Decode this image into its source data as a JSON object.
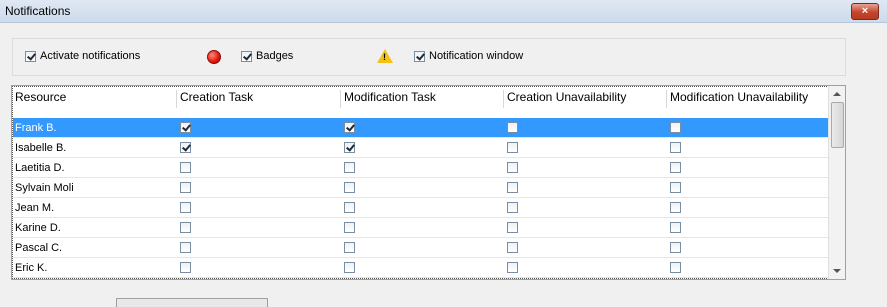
{
  "window": {
    "title": "Notifications",
    "close_label": "×"
  },
  "options": {
    "activate": {
      "label": "Activate notifications",
      "checked": true
    },
    "badges": {
      "label": "Badges",
      "checked": true
    },
    "window": {
      "label": "Notification window",
      "checked": true
    }
  },
  "icons": {
    "status_dot": "red-circle-icon",
    "warning": "warning-triangle-icon"
  },
  "columns": [
    "Resource",
    "Creation Task",
    "Modification Task",
    "Creation Unavailability",
    "Modification Unavailability"
  ],
  "rows": [
    {
      "name": "Frank B.",
      "checks": [
        true,
        true,
        false,
        false
      ],
      "selected": true
    },
    {
      "name": "Isabelle B.",
      "checks": [
        true,
        true,
        false,
        false
      ],
      "selected": false
    },
    {
      "name": "Laetitia D.",
      "checks": [
        false,
        false,
        false,
        false
      ],
      "selected": false
    },
    {
      "name": "Sylvain Moli",
      "checks": [
        false,
        false,
        false,
        false
      ],
      "selected": false
    },
    {
      "name": "Jean M.",
      "checks": [
        false,
        false,
        false,
        false
      ],
      "selected": false
    },
    {
      "name": "Karine D.",
      "checks": [
        false,
        false,
        false,
        false
      ],
      "selected": false
    },
    {
      "name": "Pascal C.",
      "checks": [
        false,
        false,
        false,
        false
      ],
      "selected": false
    },
    {
      "name": "Eric K.",
      "checks": [
        false,
        false,
        false,
        false
      ],
      "selected": false
    }
  ],
  "colors": {
    "selection": "#3399ff",
    "warning": "#f2c21b",
    "status_dot": "#e0160c"
  }
}
